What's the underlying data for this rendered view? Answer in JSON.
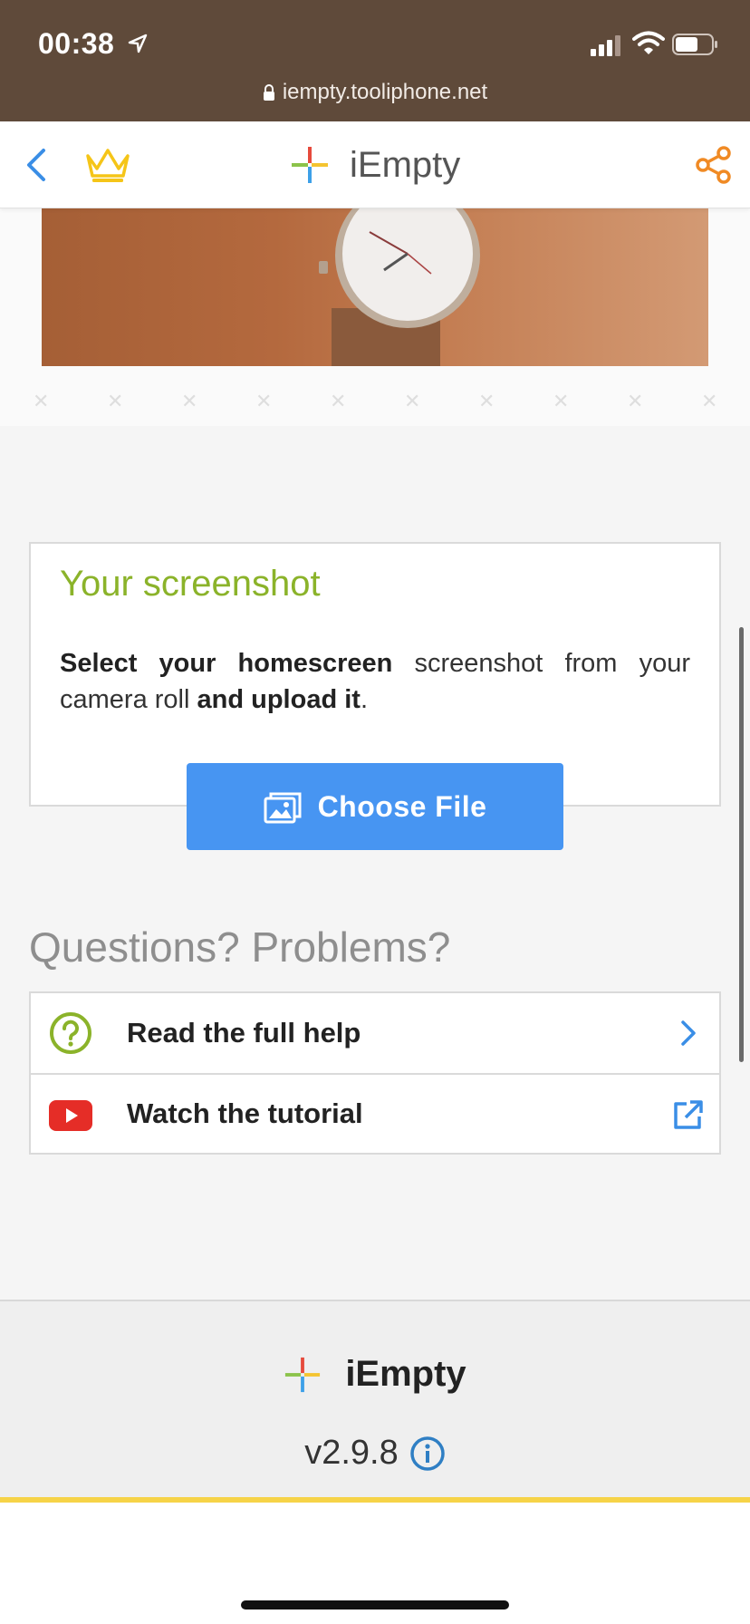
{
  "status_bar": {
    "time": "00:38",
    "url": "iempty.tooliphone.net",
    "icons": [
      "location-arrow-icon",
      "signal-icon",
      "wifi-icon",
      "battery-icon",
      "lock-icon"
    ]
  },
  "nav": {
    "title": "iEmpty",
    "icons": [
      "back-chevron-icon",
      "crown-icon",
      "plus-logo-icon",
      "share-icon"
    ],
    "colors": {
      "back": "#3a8ee6",
      "crown": "#f5c518",
      "share": "#f08a24"
    }
  },
  "card": {
    "title": "Your screenshot",
    "text_bold_1": "Select your homescreen",
    "text_1": " screenshot from your camera roll ",
    "text_bold_2": "and upload it",
    "text_2": ".",
    "button_label": "Choose File",
    "title_color": "#8bb32a",
    "button_color": "#4795f2"
  },
  "questions": {
    "heading": "Questions? Problems?",
    "items": [
      {
        "label": "Read the full help",
        "icon": "question-circle-icon",
        "right_icon": "chevron-right-icon"
      },
      {
        "label": "Watch the tutorial",
        "icon": "youtube-icon",
        "right_icon": "external-link-icon"
      }
    ]
  },
  "footer": {
    "title": "iEmpty",
    "version": "v2.9.8",
    "icons": [
      "plus-logo-icon",
      "info-icon"
    ]
  }
}
